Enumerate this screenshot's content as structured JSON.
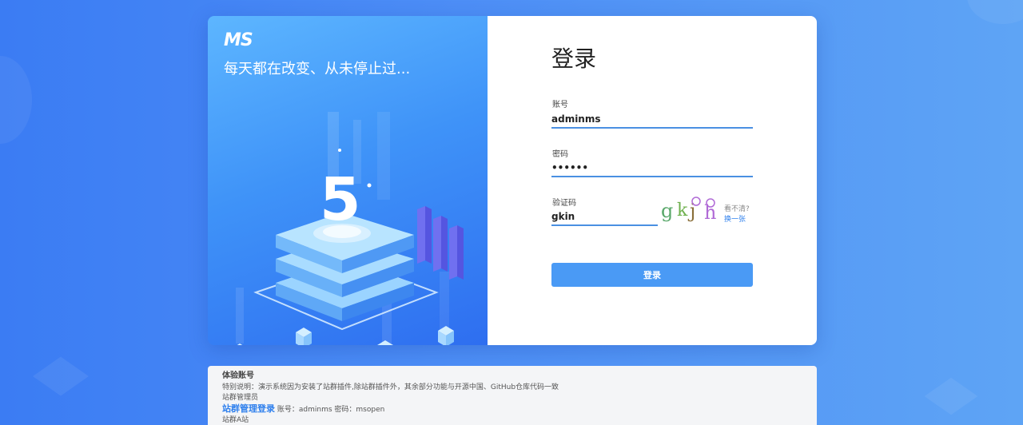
{
  "brand": {
    "logo": "MS",
    "slogan": "每天都在改变、从未停止过..."
  },
  "illustration": {
    "number": "5"
  },
  "form": {
    "title": "登录",
    "account_label": "账号",
    "account_value": "adminms",
    "password_label": "密码",
    "password_value": "••••••",
    "captcha_label": "验证码",
    "captcha_value": "gkin",
    "captcha_chars": [
      "g",
      "k",
      "j",
      "h"
    ],
    "captcha_hint": "看不清?",
    "captcha_refresh": "换一张",
    "submit_label": "登录"
  },
  "info": {
    "title": "体验账号",
    "note": "特别说明：演示系统因为安装了站群插件,除站群插件外，其余部分功能与开源中国、GitHub仓库代码一致",
    "role1": "站群管理员",
    "link1": "站群管理登录",
    "creds1": "账号：adminms 密码：msopen",
    "role2": "站群A站"
  },
  "colors": {
    "primary": "#4a9af5",
    "bg": "#4d8ef6",
    "link": "#2f80ed"
  }
}
